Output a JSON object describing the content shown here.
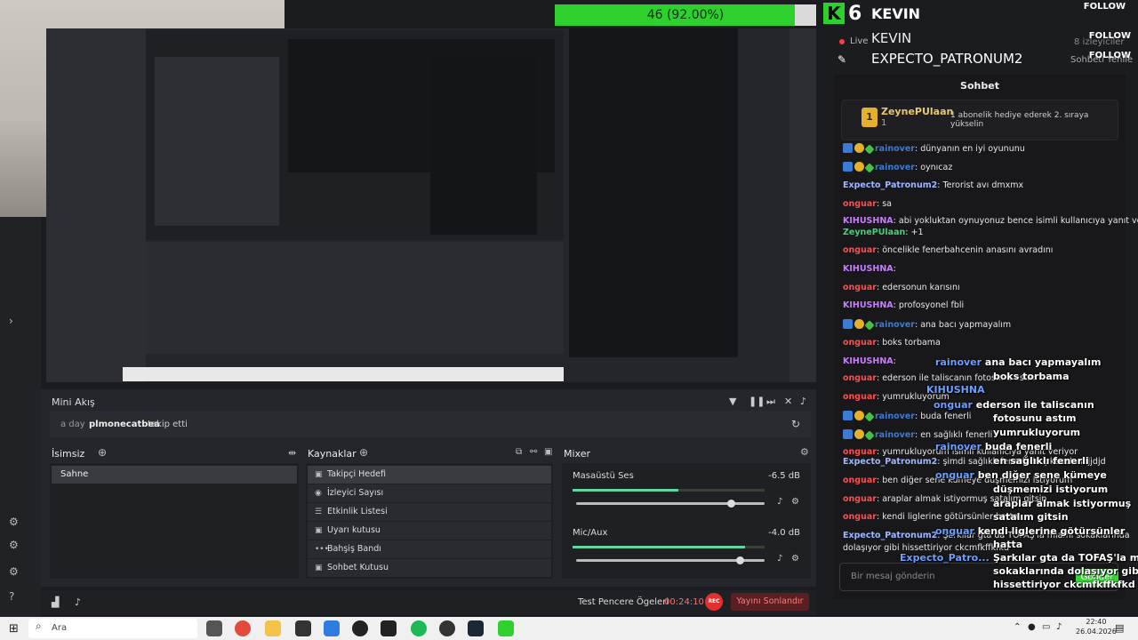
{
  "overlay": {
    "goal_text": "46 (92.00%)",
    "goal_fraction": 0.92,
    "sub_count": "6",
    "streamer": "KEVIN",
    "streamer2": "KEVIN",
    "title": "EXPECTO_PATRONUM2",
    "follow": "FOLLOW",
    "live_label": "Live",
    "viewers": "8 izleyiciler",
    "chat_settings": "Sohbeti Yenile"
  },
  "chat": {
    "header": "Sohbet",
    "hype": {
      "user": "ZeynePUlaan",
      "level": "1",
      "text": "1 abonelik hediye ederek 2. sıraya yükselin"
    },
    "input_placeholder": "Bir mesaj gönderin",
    "send_label": "Gönder",
    "messages": [
      {
        "user": "rainover",
        "text": "dünyanın en iyi oyununu",
        "color": "#3a7bd5"
      },
      {
        "user": "rainover",
        "text": "oynıcaz",
        "color": "#3a7bd5"
      },
      {
        "user": "Expecto_Patronum2",
        "text": "Terorist avı dmxmx",
        "color": "#9fb6ff"
      },
      {
        "user": "onguar",
        "text": "sa",
        "color": "#ff4d4d"
      },
      {
        "user": "KIHUSHNA",
        "text": "abi yokluktan oynuyonuz bence isimli kullanıcıya yanıt veriyor",
        "color": "#c77dff"
      },
      {
        "user": "ZeynePUlaan",
        "text": "+1",
        "color": "#43d17a"
      },
      {
        "user": "onguar",
        "text": "öncelikle fenerbahcenin anasını avradını",
        "color": "#ff4d4d"
      },
      {
        "user": "KIHUSHNA",
        "text": "",
        "color": "#c77dff"
      },
      {
        "user": "onguar",
        "text": "edersonun karısını",
        "color": "#ff4d4d"
      },
      {
        "user": "KIHUSHNA",
        "text": "profosyonel fbli",
        "color": "#c77dff"
      },
      {
        "user": "rainover",
        "text": "ana bacı yapmayalım",
        "color": "#3a7bd5"
      },
      {
        "user": "onguar",
        "text": "boks torbama",
        "color": "#ff4d4d"
      },
      {
        "user": "KIHUSHNA",
        "text": "",
        "color": "#c77dff"
      },
      {
        "user": "onguar",
        "text": "ederson ile taliscanın fotosunu astım",
        "color": "#ff4d4d"
      },
      {
        "user": "onguar",
        "text": "yumrukluyorum",
        "color": "#ff4d4d"
      },
      {
        "user": "rainover",
        "text": "buda fenerli",
        "color": "#3a7bd5"
      },
      {
        "user": "rainover",
        "text": "en sağlıklı fenerli",
        "color": "#3a7bd5"
      },
      {
        "user": "onguar",
        "text": "yumrukluyorum isimli kullanıcıya yanıt veriyor",
        "color": "#ff4d4d"
      },
      {
        "user": "Expecto_Patronum2",
        "text": "şimdi sağlıklı fenerli de çıkacak ndjjdjd",
        "color": "#9fb6ff"
      },
      {
        "user": "onguar",
        "text": "ben diğer sene kümeye düşmemizi istiyorum",
        "color": "#ff4d4d"
      },
      {
        "user": "onguar",
        "text": "araplar almak istiyormuş satalım gitsin",
        "color": "#ff4d4d"
      },
      {
        "user": "onguar",
        "text": "kendi liglerine götürsünler hatta",
        "color": "#ff4d4d"
      },
      {
        "user": "Expecto_Patronum2",
        "text": "Şarkılar gta da TOFAŞ'la miami sokaklarında",
        "color": "#9fb6ff"
      },
      {
        "user": "",
        "text": "dolaşıyor gibi hissettiriyor ckcmfkffkfkd",
        "color": "#e6e6e6"
      }
    ]
  },
  "overlay_chat": [
    {
      "user": "rainover",
      "text": "ana bacı yapmayalım"
    },
    {
      "user": "",
      "text": "boks torbama"
    },
    {
      "user": "KIHUSHNA",
      "text": ""
    },
    {
      "user": "onguar",
      "text": "ederson ile taliscanın"
    },
    {
      "user": "",
      "text": "fotosunu astım"
    },
    {
      "user": "",
      "text": "yumrukluyorum"
    },
    {
      "user": "rainover",
      "text": "buda fenerli"
    },
    {
      "user": "",
      "text": "en sağlıklı fenerli"
    },
    {
      "user": "onguar",
      "text": "ben diğer sene kümeye"
    },
    {
      "user": "",
      "text": "düşmemizi istiyorum"
    },
    {
      "user": "",
      "text": "araplar almak istiyormuş"
    },
    {
      "user": "",
      "text": "satalım gitsin"
    },
    {
      "user": "onguar",
      "text": "kendi liglerine götürsünler"
    },
    {
      "user": "",
      "text": "hatta"
    },
    {
      "user": "",
      "text": "Şarkılar gta da TOFAŞ'la miami"
    },
    {
      "user": "",
      "text": "sokaklarında dolaşıyor gibi"
    },
    {
      "user": "",
      "text": "hissettiriyor ckcmfkffkfkd"
    },
    {
      "user": "Expecto_Patro...",
      "text": ""
    }
  ],
  "dock": {
    "mini_akis": "Mini Akış",
    "feed": {
      "time": "a day",
      "user": "plmonecatbea",
      "action": "takip etti"
    },
    "scenes_title": "İsimsiz",
    "scene": "Sahne",
    "sources_title": "Kaynaklar",
    "sources": [
      {
        "label": "Takipçi Hedefi",
        "icon": "image-icon"
      },
      {
        "label": "İzleyici Sayısı",
        "icon": "eye-icon"
      },
      {
        "label": "Etkinlik Listesi",
        "icon": "list-icon"
      },
      {
        "label": "Uyarı kutusu",
        "icon": "alert-icon"
      },
      {
        "label": "Bahşiş Bandı",
        "icon": "dots-icon"
      },
      {
        "label": "Sohbet Kutusu",
        "icon": "chat-icon"
      }
    ],
    "mixer_title": "Mixer",
    "mixer": [
      {
        "name": "Masaüstü Ses",
        "db": "-6.5 dB",
        "level": 0.55,
        "volume": 0.82
      },
      {
        "name": "Mic/Aux",
        "db": "-4.0 dB",
        "level": 0.9,
        "volume": 0.87
      }
    ],
    "test_label": "Test Pencere Ögeleri",
    "timer": "00:24:10",
    "rec": "REC",
    "end_stream": "Yayını Sonlandır"
  },
  "taskbar": {
    "search_placeholder": "Ara",
    "time": "22:40",
    "date": "26.04.2026"
  }
}
